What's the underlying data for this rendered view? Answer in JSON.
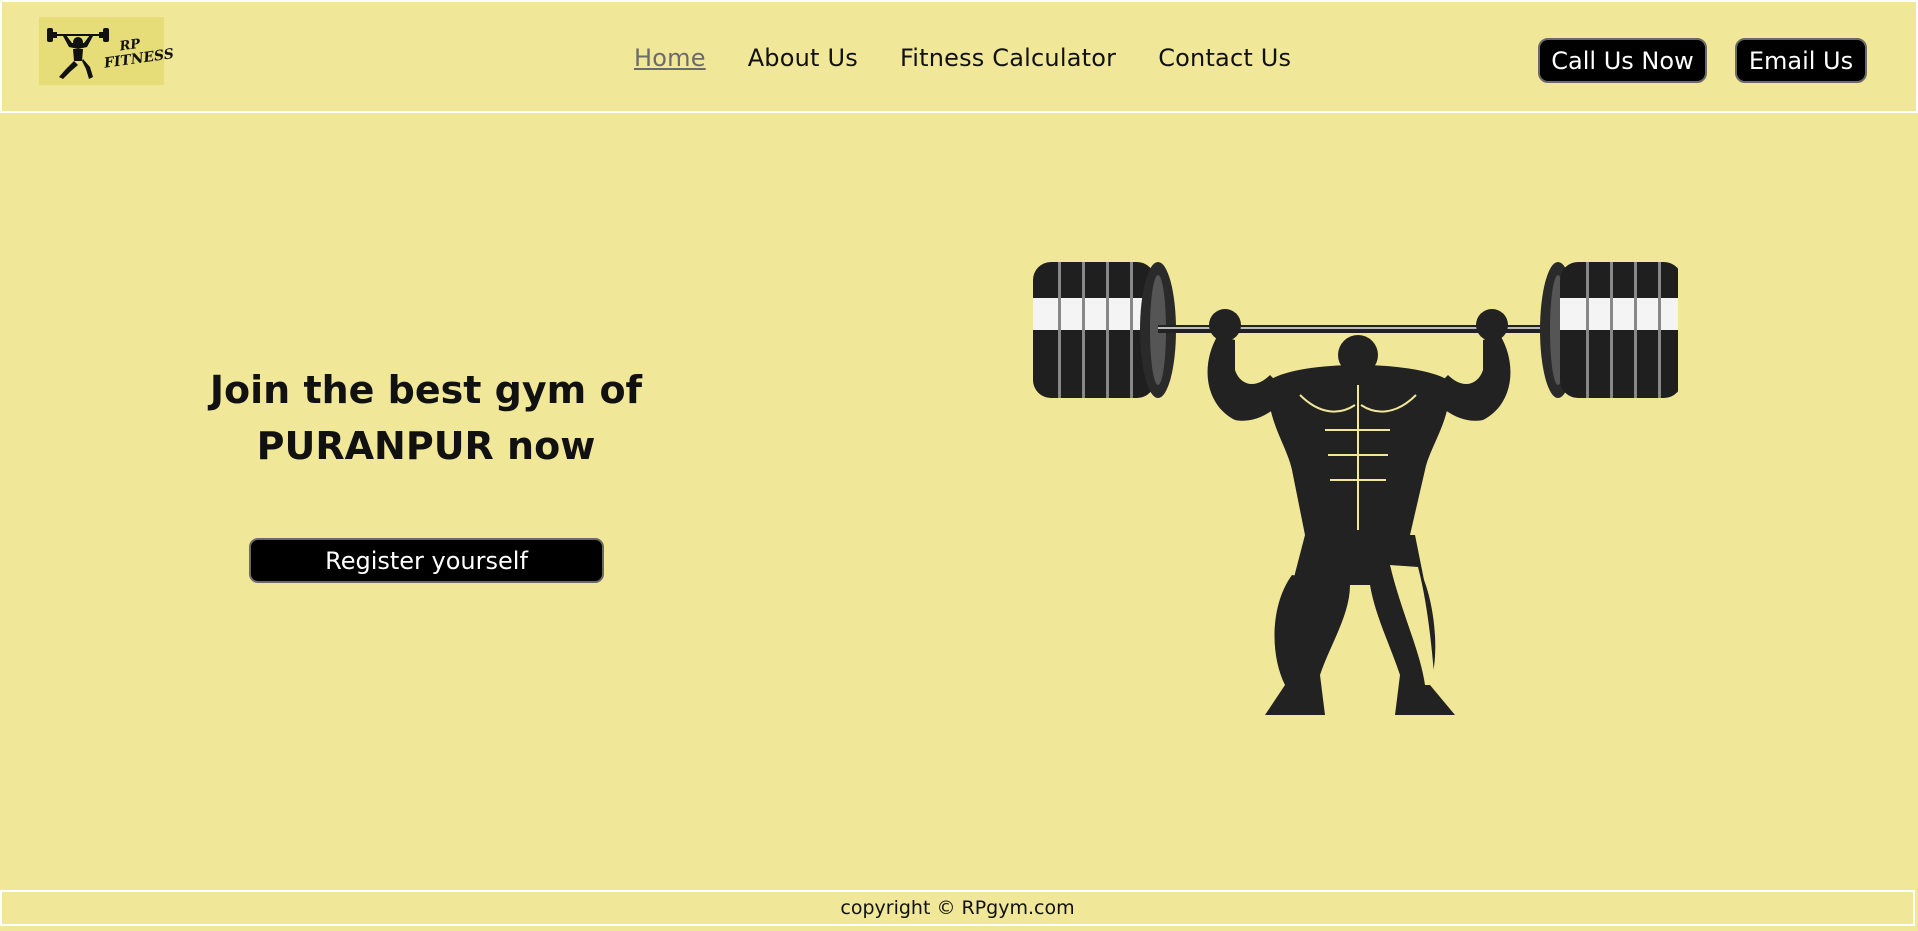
{
  "brand": {
    "logo_line1": "RP",
    "logo_line2": "FITNESS"
  },
  "nav": {
    "items": [
      {
        "label": "Home",
        "active": true
      },
      {
        "label": "About Us",
        "active": false
      },
      {
        "label": "Fitness Calculator",
        "active": false
      },
      {
        "label": "Contact Us",
        "active": false
      }
    ]
  },
  "header_actions": {
    "call_label": "Call Us Now",
    "email_label": "Email Us"
  },
  "hero": {
    "title_line1": "Join the best gym of",
    "title_line2": "PURANPUR now",
    "register_label": "Register yourself"
  },
  "footer": {
    "copyright": "copyright © RPgym.com"
  },
  "colors": {
    "background": "#f0e798",
    "button": "#000000",
    "button_text": "#ffffff",
    "active_nav": "#6b6b6b"
  }
}
